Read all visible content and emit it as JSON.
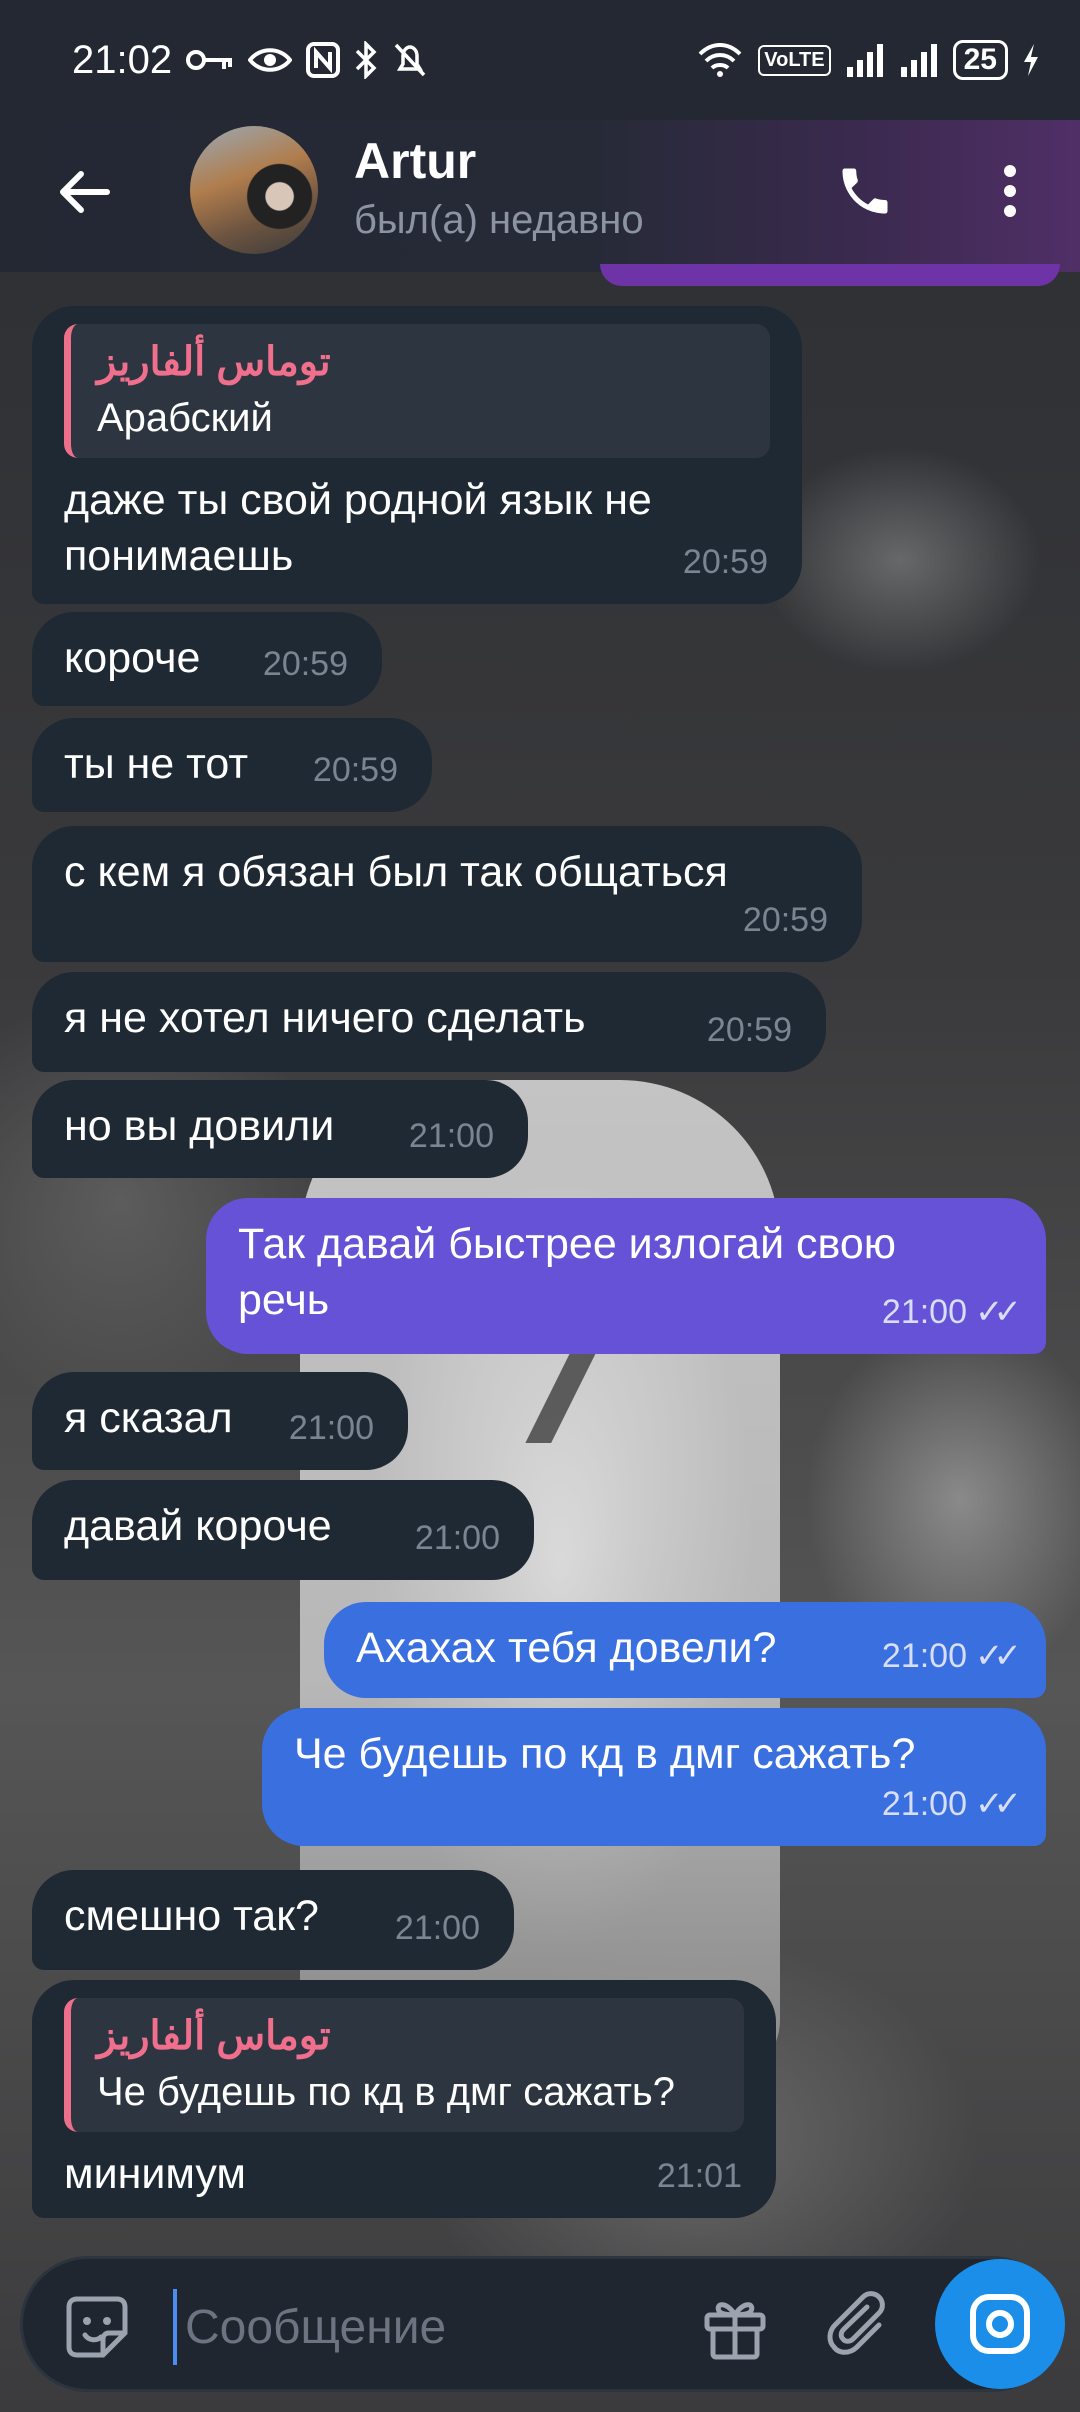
{
  "status_bar": {
    "time": "21:02",
    "battery": "25",
    "volte": "VoLTE"
  },
  "header": {
    "contact_name": "Artur",
    "contact_status": "был(а) недавно"
  },
  "messages": [
    {
      "dir": "in",
      "reply_name": "توماس ألفاريز",
      "reply_text": "Арабский",
      "text": "даже ты свой родной язык не понимаешь",
      "time": "20:59"
    },
    {
      "dir": "in",
      "text": "короче",
      "time": "20:59"
    },
    {
      "dir": "in",
      "text": "ты не тот",
      "time": "20:59"
    },
    {
      "dir": "in",
      "text": "с кем я обязан был так общаться",
      "time": "20:59"
    },
    {
      "dir": "in",
      "text": "я не хотел ничего сделать",
      "time": "20:59"
    },
    {
      "dir": "in",
      "text": "но вы довили",
      "time": "21:00"
    },
    {
      "dir": "out",
      "text": "Так давай быстрее излогай свою речь",
      "time": "21:00",
      "read": true
    },
    {
      "dir": "in",
      "text": "я сказал",
      "time": "21:00"
    },
    {
      "dir": "in",
      "text": "давай короче",
      "time": "21:00"
    },
    {
      "dir": "out",
      "text": "Ахахах тебя довели?",
      "time": "21:00",
      "read": true
    },
    {
      "dir": "out",
      "text": "Че будешь по кд в дмг сажать?",
      "time": "21:00",
      "read": true
    },
    {
      "dir": "in",
      "text": "смешно так?",
      "time": "21:00"
    },
    {
      "dir": "in",
      "reply_name": "توماس ألفاريز",
      "reply_text": "Че будешь по кд в дмг сажать?",
      "text": "минимум",
      "time": "21:01"
    }
  ],
  "input": {
    "placeholder": "Сообщение"
  },
  "colors": {
    "incoming_bubble": "#1f2933",
    "outgoing_purple": "#6552d6",
    "outgoing_blue": "#3a6fe0",
    "reply_accent": "#ee6f8a",
    "camera_button": "#1a8ee8"
  },
  "icons": [
    "back-arrow-icon",
    "phone-icon",
    "more-vertical-icon",
    "sticker-icon",
    "gift-icon",
    "paperclip-icon",
    "camera-icon",
    "key-icon",
    "eye-icon",
    "nfc-icon",
    "bluetooth-icon",
    "bell-off-icon",
    "wifi-icon",
    "signal-icon",
    "battery-icon",
    "charging-icon",
    "double-check-icon"
  ]
}
